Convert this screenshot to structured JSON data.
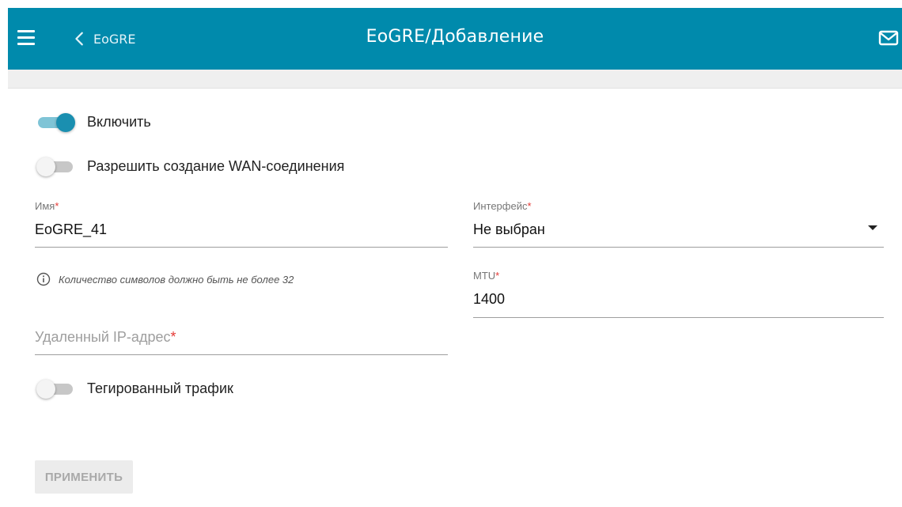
{
  "header": {
    "title": "EoGRE/Добавление",
    "back_label": "EoGRE",
    "menu_icon": "hamburger-menu-icon",
    "back_icon": "chevron-left-icon",
    "mail_icon": "mail-icon",
    "color": "#008aac"
  },
  "form": {
    "enable": {
      "label": "Включить",
      "checked": true
    },
    "allow_wan": {
      "label": "Разрешить создание WAN-соединения",
      "checked": false
    },
    "name": {
      "label": "Имя",
      "required_mark": "*",
      "value": "EoGRE_41"
    },
    "name_hint": "Количество символов должно быть не более 32",
    "interface": {
      "label": "Интерфейс",
      "required_mark": "*",
      "value": "Не выбран"
    },
    "mtu": {
      "label": "MTU",
      "required_mark": "*",
      "value": "1400"
    },
    "remote_ip": {
      "placeholder": "Удаленный IP-адрес",
      "required_mark": "*"
    },
    "tagged": {
      "label": "Тегированный трафик",
      "checked": false
    },
    "apply_label": "ПРИМЕНИТЬ"
  }
}
